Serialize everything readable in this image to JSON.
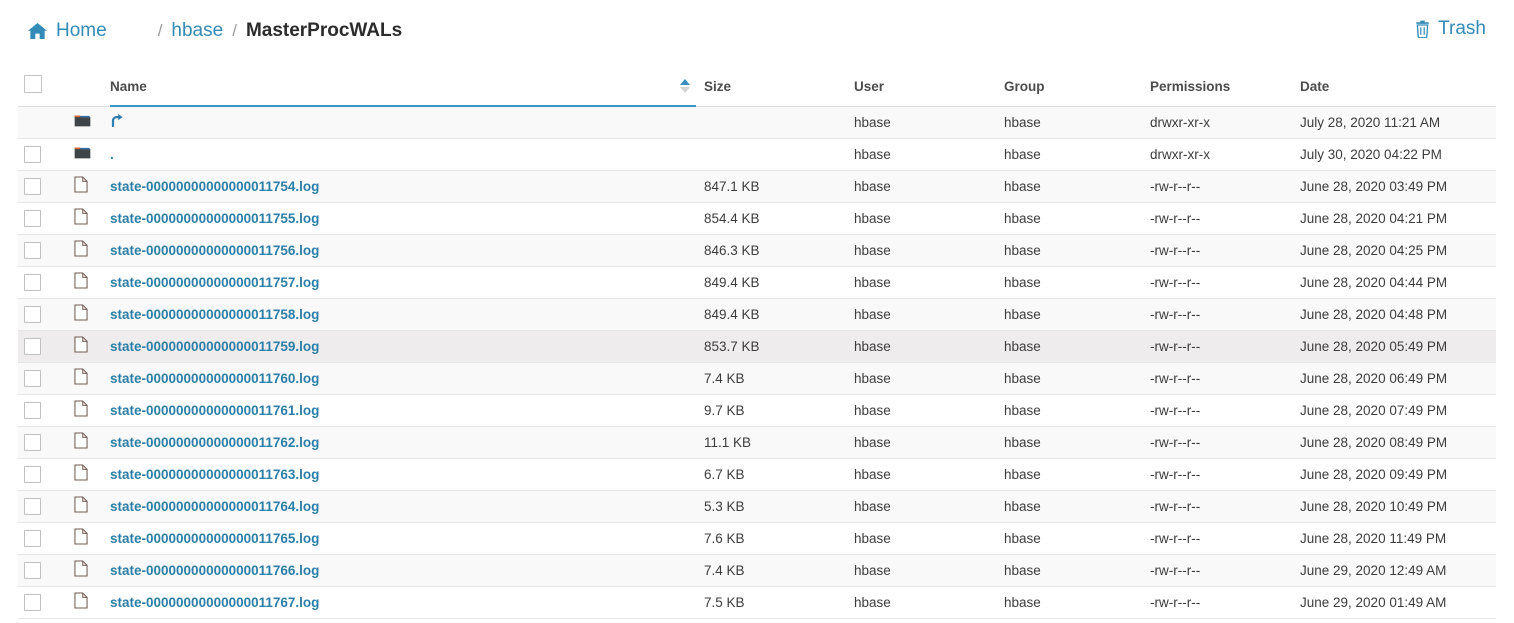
{
  "breadcrumb": {
    "home_label": "Home",
    "home_icon": "home-icon",
    "separator": "/",
    "parent_label": "hbase",
    "current_label": "MasterProcWALs"
  },
  "toolbar": {
    "trash_label": "Trash",
    "trash_icon": "trash-icon"
  },
  "table": {
    "columns": {
      "name": "Name",
      "size": "Size",
      "user": "User",
      "group": "Group",
      "permissions": "Permissions",
      "date": "Date"
    },
    "sort": {
      "column": "Name",
      "direction": "ascending",
      "icon": "sort-ascending-icon"
    },
    "select_all_checkbox": "unchecked",
    "rows": [
      {
        "icon": "folder-icon",
        "name": "⤴",
        "name_kind": "parent-directory-link",
        "size": "",
        "user": "hbase",
        "group": "hbase",
        "permissions": "drwxr-xr-x",
        "date": "July 28, 2020 11:21 AM",
        "checkbox": false,
        "shade": "zebra"
      },
      {
        "icon": "folder-icon",
        "name": ".",
        "name_kind": "current-directory-link",
        "size": "",
        "user": "hbase",
        "group": "hbase",
        "permissions": "drwxr-xr-x",
        "date": "July 30, 2020 04:22 PM",
        "checkbox": true,
        "shade": "plain"
      },
      {
        "icon": "file-icon",
        "name": "state-00000000000000011754.log",
        "name_kind": "file-link",
        "size": "847.1 KB",
        "user": "hbase",
        "group": "hbase",
        "permissions": "-rw-r--r--",
        "date": "June 28, 2020 03:49 PM",
        "checkbox": true,
        "shade": "zebra"
      },
      {
        "icon": "file-icon",
        "name": "state-00000000000000011755.log",
        "name_kind": "file-link",
        "size": "854.4 KB",
        "user": "hbase",
        "group": "hbase",
        "permissions": "-rw-r--r--",
        "date": "June 28, 2020 04:21 PM",
        "checkbox": true,
        "shade": "plain"
      },
      {
        "icon": "file-icon",
        "name": "state-00000000000000011756.log",
        "name_kind": "file-link",
        "size": "846.3 KB",
        "user": "hbase",
        "group": "hbase",
        "permissions": "-rw-r--r--",
        "date": "June 28, 2020 04:25 PM",
        "checkbox": true,
        "shade": "zebra"
      },
      {
        "icon": "file-icon",
        "name": "state-00000000000000011757.log",
        "name_kind": "file-link",
        "size": "849.4 KB",
        "user": "hbase",
        "group": "hbase",
        "permissions": "-rw-r--r--",
        "date": "June 28, 2020 04:44 PM",
        "checkbox": true,
        "shade": "plain"
      },
      {
        "icon": "file-icon",
        "name": "state-00000000000000011758.log",
        "name_kind": "file-link",
        "size": "849.4 KB",
        "user": "hbase",
        "group": "hbase",
        "permissions": "-rw-r--r--",
        "date": "June 28, 2020 04:48 PM",
        "checkbox": true,
        "shade": "zebra"
      },
      {
        "icon": "file-icon",
        "name": "state-00000000000000011759.log",
        "name_kind": "file-link",
        "size": "853.7 KB",
        "user": "hbase",
        "group": "hbase",
        "permissions": "-rw-r--r--",
        "date": "June 28, 2020 05:49 PM",
        "checkbox": true,
        "shade": "hovered"
      },
      {
        "icon": "file-icon",
        "name": "state-00000000000000011760.log",
        "name_kind": "file-link",
        "size": "7.4 KB",
        "user": "hbase",
        "group": "hbase",
        "permissions": "-rw-r--r--",
        "date": "June 28, 2020 06:49 PM",
        "checkbox": true,
        "shade": "zebra"
      },
      {
        "icon": "file-icon",
        "name": "state-00000000000000011761.log",
        "name_kind": "file-link",
        "size": "9.7 KB",
        "user": "hbase",
        "group": "hbase",
        "permissions": "-rw-r--r--",
        "date": "June 28, 2020 07:49 PM",
        "checkbox": true,
        "shade": "plain"
      },
      {
        "icon": "file-icon",
        "name": "state-00000000000000011762.log",
        "name_kind": "file-link",
        "size": "11.1 KB",
        "user": "hbase",
        "group": "hbase",
        "permissions": "-rw-r--r--",
        "date": "June 28, 2020 08:49 PM",
        "checkbox": true,
        "shade": "zebra"
      },
      {
        "icon": "file-icon",
        "name": "state-00000000000000011763.log",
        "name_kind": "file-link",
        "size": "6.7 KB",
        "user": "hbase",
        "group": "hbase",
        "permissions": "-rw-r--r--",
        "date": "June 28, 2020 09:49 PM",
        "checkbox": true,
        "shade": "plain"
      },
      {
        "icon": "file-icon",
        "name": "state-00000000000000011764.log",
        "name_kind": "file-link",
        "size": "5.3 KB",
        "user": "hbase",
        "group": "hbase",
        "permissions": "-rw-r--r--",
        "date": "June 28, 2020 10:49 PM",
        "checkbox": true,
        "shade": "zebra"
      },
      {
        "icon": "file-icon",
        "name": "state-00000000000000011765.log",
        "name_kind": "file-link",
        "size": "7.6 KB",
        "user": "hbase",
        "group": "hbase",
        "permissions": "-rw-r--r--",
        "date": "June 28, 2020 11:49 PM",
        "checkbox": true,
        "shade": "plain"
      },
      {
        "icon": "file-icon",
        "name": "state-00000000000000011766.log",
        "name_kind": "file-link",
        "size": "7.4 KB",
        "user": "hbase",
        "group": "hbase",
        "permissions": "-rw-r--r--",
        "date": "June 29, 2020 12:49 AM",
        "checkbox": true,
        "shade": "zebra"
      },
      {
        "icon": "file-icon",
        "name": "state-00000000000000011767.log",
        "name_kind": "file-link",
        "size": "7.5 KB",
        "user": "hbase",
        "group": "hbase",
        "permissions": "-rw-r--r--",
        "date": "June 29, 2020 01:49 AM",
        "checkbox": true,
        "shade": "plain"
      }
    ]
  },
  "colors": {
    "link": "#2b7fa8",
    "accent": "#3b96c8",
    "zebra_row": "#f9f9f9",
    "hover_row": "#efecee",
    "border": "#e6e6e6"
  }
}
